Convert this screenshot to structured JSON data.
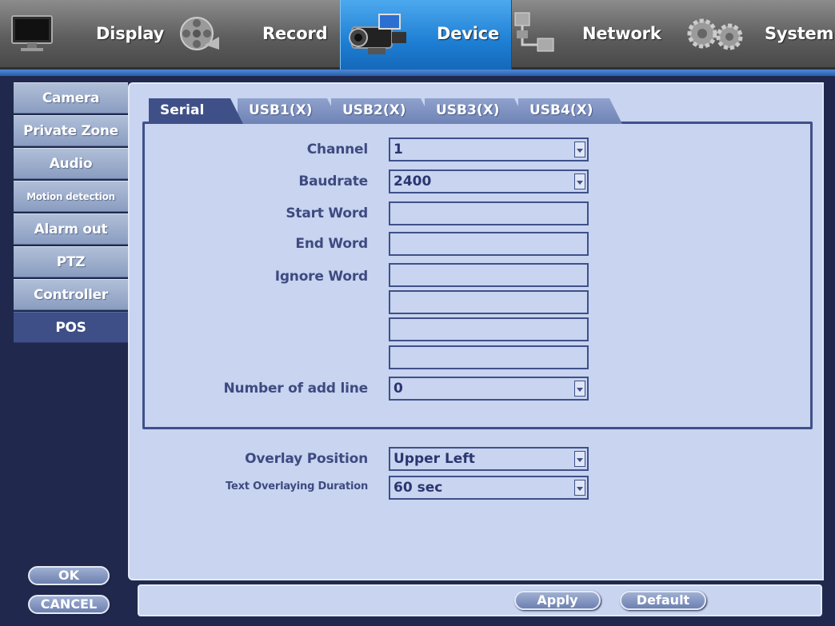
{
  "topnav": {
    "items": [
      {
        "label": "Display",
        "icon": "monitor-icon"
      },
      {
        "label": "Record",
        "icon": "film-reel-icon"
      },
      {
        "label": "Device",
        "icon": "camcorder-icon"
      },
      {
        "label": "Network",
        "icon": "network-icon"
      },
      {
        "label": "System",
        "icon": "gears-icon"
      }
    ],
    "active": "Device"
  },
  "sidebar": {
    "items": [
      {
        "label": "Camera"
      },
      {
        "label": "Private Zone"
      },
      {
        "label": "Audio"
      },
      {
        "label": "Motion detection"
      },
      {
        "label": "Alarm out"
      },
      {
        "label": "PTZ"
      },
      {
        "label": "Controller"
      },
      {
        "label": "POS"
      }
    ],
    "active": "POS"
  },
  "tabs": [
    {
      "label": "Serial"
    },
    {
      "label": "USB1(X)"
    },
    {
      "label": "USB2(X)"
    },
    {
      "label": "USB3(X)"
    },
    {
      "label": "USB4(X)"
    }
  ],
  "form": {
    "channel": {
      "label": "Channel",
      "value": "1"
    },
    "baudrate": {
      "label": "Baudrate",
      "value": "2400"
    },
    "start_word": {
      "label": "Start Word",
      "value": ""
    },
    "end_word": {
      "label": "End Word",
      "value": ""
    },
    "ignore_word": {
      "label": "Ignore Word",
      "values": [
        "",
        "",
        "",
        ""
      ]
    },
    "add_line": {
      "label": "Number of add line",
      "value": "0"
    },
    "overlay_position": {
      "label": "Overlay Position",
      "value": "Upper Left"
    },
    "overlay_duration": {
      "label": "Text Overlaying Duration",
      "value": "60 sec"
    }
  },
  "buttons": {
    "ok": "OK",
    "cancel": "CANCEL",
    "apply": "Apply",
    "default": "Default"
  },
  "colors": {
    "active_tab": "#3f5089",
    "panel_bg": "#c8d4f0",
    "device_highlight": "#1e7fd4"
  }
}
